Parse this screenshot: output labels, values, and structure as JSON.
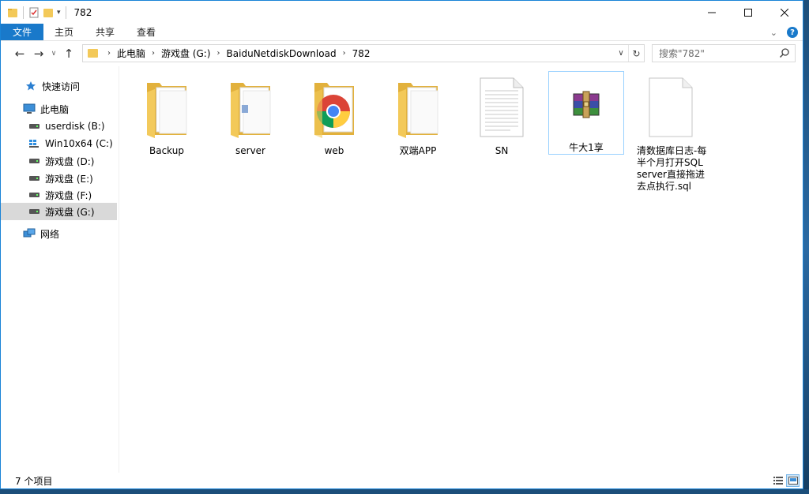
{
  "window": {
    "title": "782"
  },
  "ribbon": {
    "tabs": [
      {
        "label": "文件"
      },
      {
        "label": "主页"
      },
      {
        "label": "共享"
      },
      {
        "label": "查看"
      }
    ]
  },
  "address": {
    "crumbs": [
      "此电脑",
      "游戏盘 (G:)",
      "BaiduNetdiskDownload",
      "782"
    ]
  },
  "search": {
    "placeholder": "搜索\"782\""
  },
  "sidebar": {
    "quick_access": "快速访问",
    "this_pc": "此电脑",
    "drives": [
      {
        "label": "userdisk (B:)"
      },
      {
        "label": "Win10x64 (C:)"
      },
      {
        "label": "游戏盘 (D:)"
      },
      {
        "label": "游戏盘 (E:)"
      },
      {
        "label": "游戏盘 (F:)"
      },
      {
        "label": "游戏盘 (G:)"
      }
    ],
    "network": "网络"
  },
  "files": [
    {
      "name": "Backup",
      "type": "folder"
    },
    {
      "name": "server",
      "type": "folder"
    },
    {
      "name": "web",
      "type": "folder-chrome"
    },
    {
      "name": "双端APP",
      "type": "folder"
    },
    {
      "name": "SN",
      "type": "text-file"
    },
    {
      "name": "牛大1享",
      "type": "archive"
    },
    {
      "name": "清数据库日志-每半个月打开SQL server直接拖进去点执行.sql",
      "type": "sql-file"
    }
  ],
  "status": {
    "item_count": "7 个项目"
  },
  "colors": {
    "accent": "#1979ca",
    "folder": "#f3c959",
    "selection": "#99d1ff"
  }
}
